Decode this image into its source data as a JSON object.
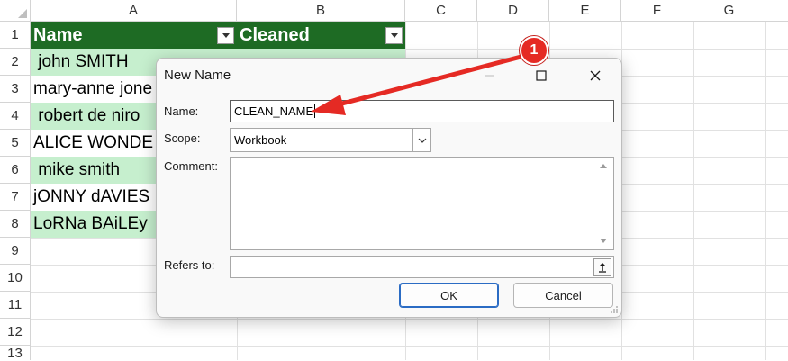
{
  "sheet": {
    "columns": [
      "A",
      "B",
      "C",
      "D",
      "E",
      "F",
      "G"
    ],
    "rows": [
      "1",
      "2",
      "3",
      "4",
      "5",
      "6",
      "7",
      "8",
      "9",
      "10",
      "11",
      "12",
      "13"
    ],
    "table": {
      "headers": [
        "Name",
        "Cleaned"
      ],
      "cells": [
        " john SMITH",
        "mary-anne jone",
        " robert de niro",
        "ALICE WONDE",
        " mike smith",
        "jONNY dAVIES",
        "LoRNa BAiLEy"
      ]
    }
  },
  "dialog": {
    "title": "New Name",
    "name_label": "Name:",
    "name_value": "CLEAN_NAME",
    "scope_label": "Scope:",
    "scope_value": "Workbook",
    "comment_label": "Comment:",
    "refers_label": "Refers to:",
    "refers_value": "",
    "ok_label": "OK",
    "cancel_label": "Cancel"
  },
  "annotation": {
    "badge_number": "1",
    "color": "#e52a24"
  },
  "colors": {
    "table_header": "#1e6b24",
    "band": "#c6efce"
  }
}
